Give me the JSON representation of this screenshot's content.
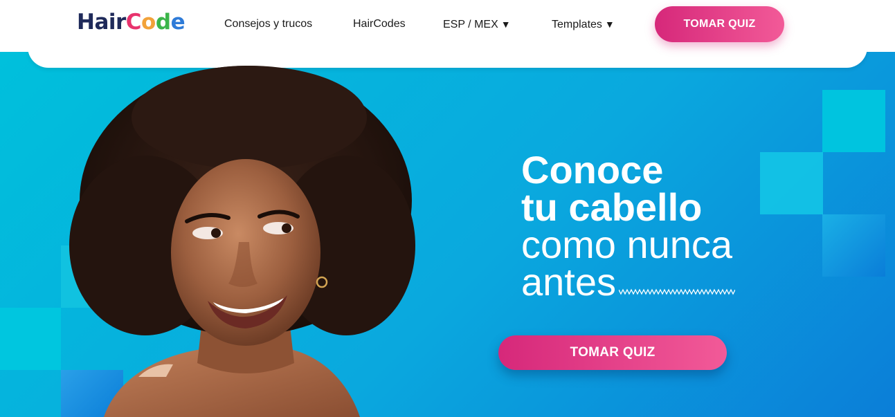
{
  "brand": {
    "logo_hair": "Hair",
    "logo_code": [
      "C",
      "o",
      "d",
      "e"
    ],
    "colors": {
      "navy": "#1f2a5a",
      "pink": "#d6287a",
      "pink_light": "#f25a98",
      "cyan": "#00c0dc",
      "blue": "#0b7ed8"
    }
  },
  "nav": {
    "items": [
      {
        "label": "Consejos y trucos"
      },
      {
        "label": "HairCodes"
      },
      {
        "label": "ESP / MEX",
        "caret": "▼"
      },
      {
        "label": "Templates",
        "caret": "▼"
      }
    ],
    "cta_label": "TOMAR QUIZ"
  },
  "hero": {
    "line1": "Conoce",
    "line2": "tu cabello",
    "line3": "como nunca",
    "line4": "antes",
    "cta_label": "TOMAR QUIZ",
    "image": "smiling-woman-afro-portrait"
  }
}
